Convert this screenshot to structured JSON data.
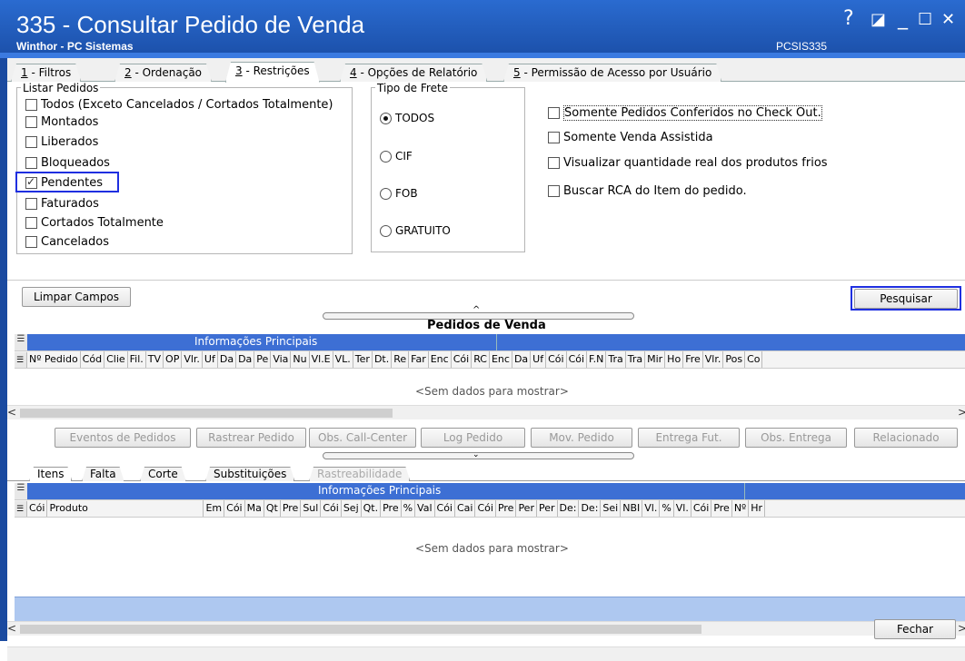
{
  "window": {
    "title": "335 - Consultar Pedido de Venda",
    "subtitle": "Winthor - PC Sistemas",
    "code": "PCSIS335",
    "controls": [
      "?",
      "◪",
      "_",
      "☐",
      "✕"
    ]
  },
  "tabs": [
    {
      "key": "1",
      "label": " - Filtros"
    },
    {
      "key": "2",
      "label": " - Ordenação"
    },
    {
      "key": "3",
      "label": " - Restrições"
    },
    {
      "key": "4",
      "label": " - Opções de Relatório"
    },
    {
      "key": "5",
      "label": " - Permissão de Acesso por Usuário"
    }
  ],
  "listar_pedidos": {
    "title": "Listar Pedidos",
    "items": [
      {
        "label": "Todos (Exceto Cancelados / Cortados Totalmente)",
        "checked": false
      },
      {
        "label": "Montados",
        "checked": false
      },
      {
        "label": "Liberados",
        "checked": false
      },
      {
        "label": "Bloqueados",
        "checked": false
      },
      {
        "label": "Pendentes",
        "checked": true
      },
      {
        "label": "Faturados",
        "checked": false
      },
      {
        "label": "Cortados Totalmente",
        "checked": false
      },
      {
        "label": "Cancelados",
        "checked": false
      }
    ]
  },
  "tipo_frete": {
    "title": "Tipo de Frete",
    "options": [
      {
        "label": "TODOS",
        "checked": true
      },
      {
        "label": "CIF",
        "checked": false
      },
      {
        "label": "FOB",
        "checked": false
      },
      {
        "label": "GRATUITO",
        "checked": false
      }
    ]
  },
  "options": [
    {
      "label": "Somente Pedidos Conferidos no Check Out.",
      "checked": false
    },
    {
      "label": "Somente Venda Assistida",
      "checked": false
    },
    {
      "label": "Visualizar quantidade real dos produtos frios",
      "checked": false
    },
    {
      "label": "Buscar RCA do Item do pedido.",
      "checked": false
    }
  ],
  "buttons": {
    "limpar": "Limpar Campos",
    "pesquisar": "Pesquisar",
    "fechar": "Fechar"
  },
  "pedidos": {
    "title": "Pedidos de Venda",
    "group_header": "Informações Principais",
    "columns": [
      "Nº Pedido",
      "Cód",
      "Clie",
      "Fil.",
      "TV",
      "OP",
      "Vlr.",
      "Uf",
      "Da",
      "Da",
      "Pe",
      "Via",
      "Nu",
      "Vl.E",
      "VL.",
      "Ter",
      "Dt.",
      "Re",
      "Far",
      "Enc",
      "Cói",
      "RC",
      "Enc",
      "Da",
      "Uf",
      "Cói",
      "Cói",
      "F.N",
      "Tra",
      "Tra",
      "Mir",
      "Ho",
      "Fre",
      "Vlr.",
      "Pos",
      "Co"
    ],
    "empty": "<Sem dados para mostrar>"
  },
  "actions": [
    {
      "label": "Eventos de Pedidos"
    },
    {
      "label": "Rastrear Pedido"
    },
    {
      "label": "Obs. Call-Center"
    },
    {
      "label": "Log Pedido"
    },
    {
      "label": "Mov. Pedido"
    },
    {
      "label": "Entrega Fut."
    },
    {
      "label": "Obs. Entrega"
    },
    {
      "label": "Relacionado"
    }
  ],
  "subtabs": [
    {
      "label": "Itens",
      "active": true
    },
    {
      "label": "Falta"
    },
    {
      "label": "Corte"
    },
    {
      "label": "Substituições"
    },
    {
      "label": "Rastreabilidade",
      "disabled": true
    }
  ],
  "itens": {
    "group_header": "Informações Principais",
    "columns": [
      "Cói",
      "Produto",
      "Em",
      "Cói",
      "Ma",
      "Qt",
      "Pre",
      "Sul",
      "Cói",
      "Sej",
      "Qt.",
      "Pre",
      "%",
      "Val",
      "Cói",
      "Cai",
      "Cói",
      "Pre",
      "Per",
      "Per",
      "De:",
      "De:",
      "Sei",
      "NBI",
      "Vl.",
      "%",
      "Vl.",
      "Cói",
      "Pre",
      "Nº",
      "Hr"
    ],
    "empty": "<Sem dados para mostrar>"
  }
}
